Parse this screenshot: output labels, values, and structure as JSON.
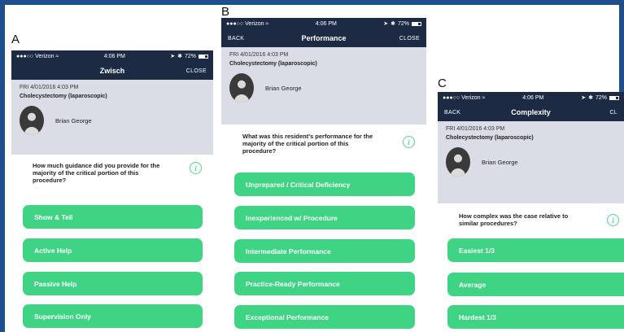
{
  "panels": {
    "a": {
      "letter": "A",
      "status": {
        "carrier": "Verizon",
        "time": "4:06 PM",
        "battery": "72%"
      },
      "nav": {
        "back": "",
        "title": "Zwisch",
        "close": "CLOSE"
      },
      "case": {
        "date": "FRI 4/01/2016   4:03 PM",
        "procedure": "Cholecystectomy (laparoscopic)",
        "resident": "Brian George"
      },
      "question": "How much guidance did you provide for the majority of the critical portion of this procedure?",
      "options": [
        "Show & Tell",
        "Active Help",
        "Passive Help",
        "Supervision Only"
      ]
    },
    "b": {
      "letter": "B",
      "status": {
        "carrier": "Verizon",
        "time": "4:06 PM",
        "battery": "72%"
      },
      "nav": {
        "back": "BACK",
        "title": "Performance",
        "close": "CLOSE"
      },
      "case": {
        "date": "FRI 4/01/2016   4:03 PM",
        "procedure": "Cholecystectomy (laparoscopic)",
        "resident": "Brian George"
      },
      "question": "What was this resident's performance for the majority of the critical portion of this procedure?",
      "options": [
        "Unprepared / Critical Deficiency",
        "Inexperienced w/ Procedure",
        "Intermediate Performance",
        "Practice-Ready Performance",
        "Exceptional Performance"
      ]
    },
    "c": {
      "letter": "C",
      "status": {
        "carrier": "Verizon",
        "time": "4:06 PM",
        "battery": "72%"
      },
      "nav": {
        "back": "BACK",
        "title": "Complexity",
        "close": "CL"
      },
      "case": {
        "date": "FRI 4/01/2016   4:03 PM",
        "procedure": "Cholecystectomy (laparoscopic)",
        "resident": "Brian George"
      },
      "question": "How complex was the case relative to similar procedures?",
      "options": [
        "Easiest 1/3",
        "Average",
        "Hardest 1/3"
      ]
    }
  },
  "info_icon_glyph": "i",
  "colors": {
    "navbar": "#1c2a44",
    "option_button": "#3ed483",
    "case_info_bg": "#dadde6",
    "frame_border": "#1f4e8c"
  }
}
